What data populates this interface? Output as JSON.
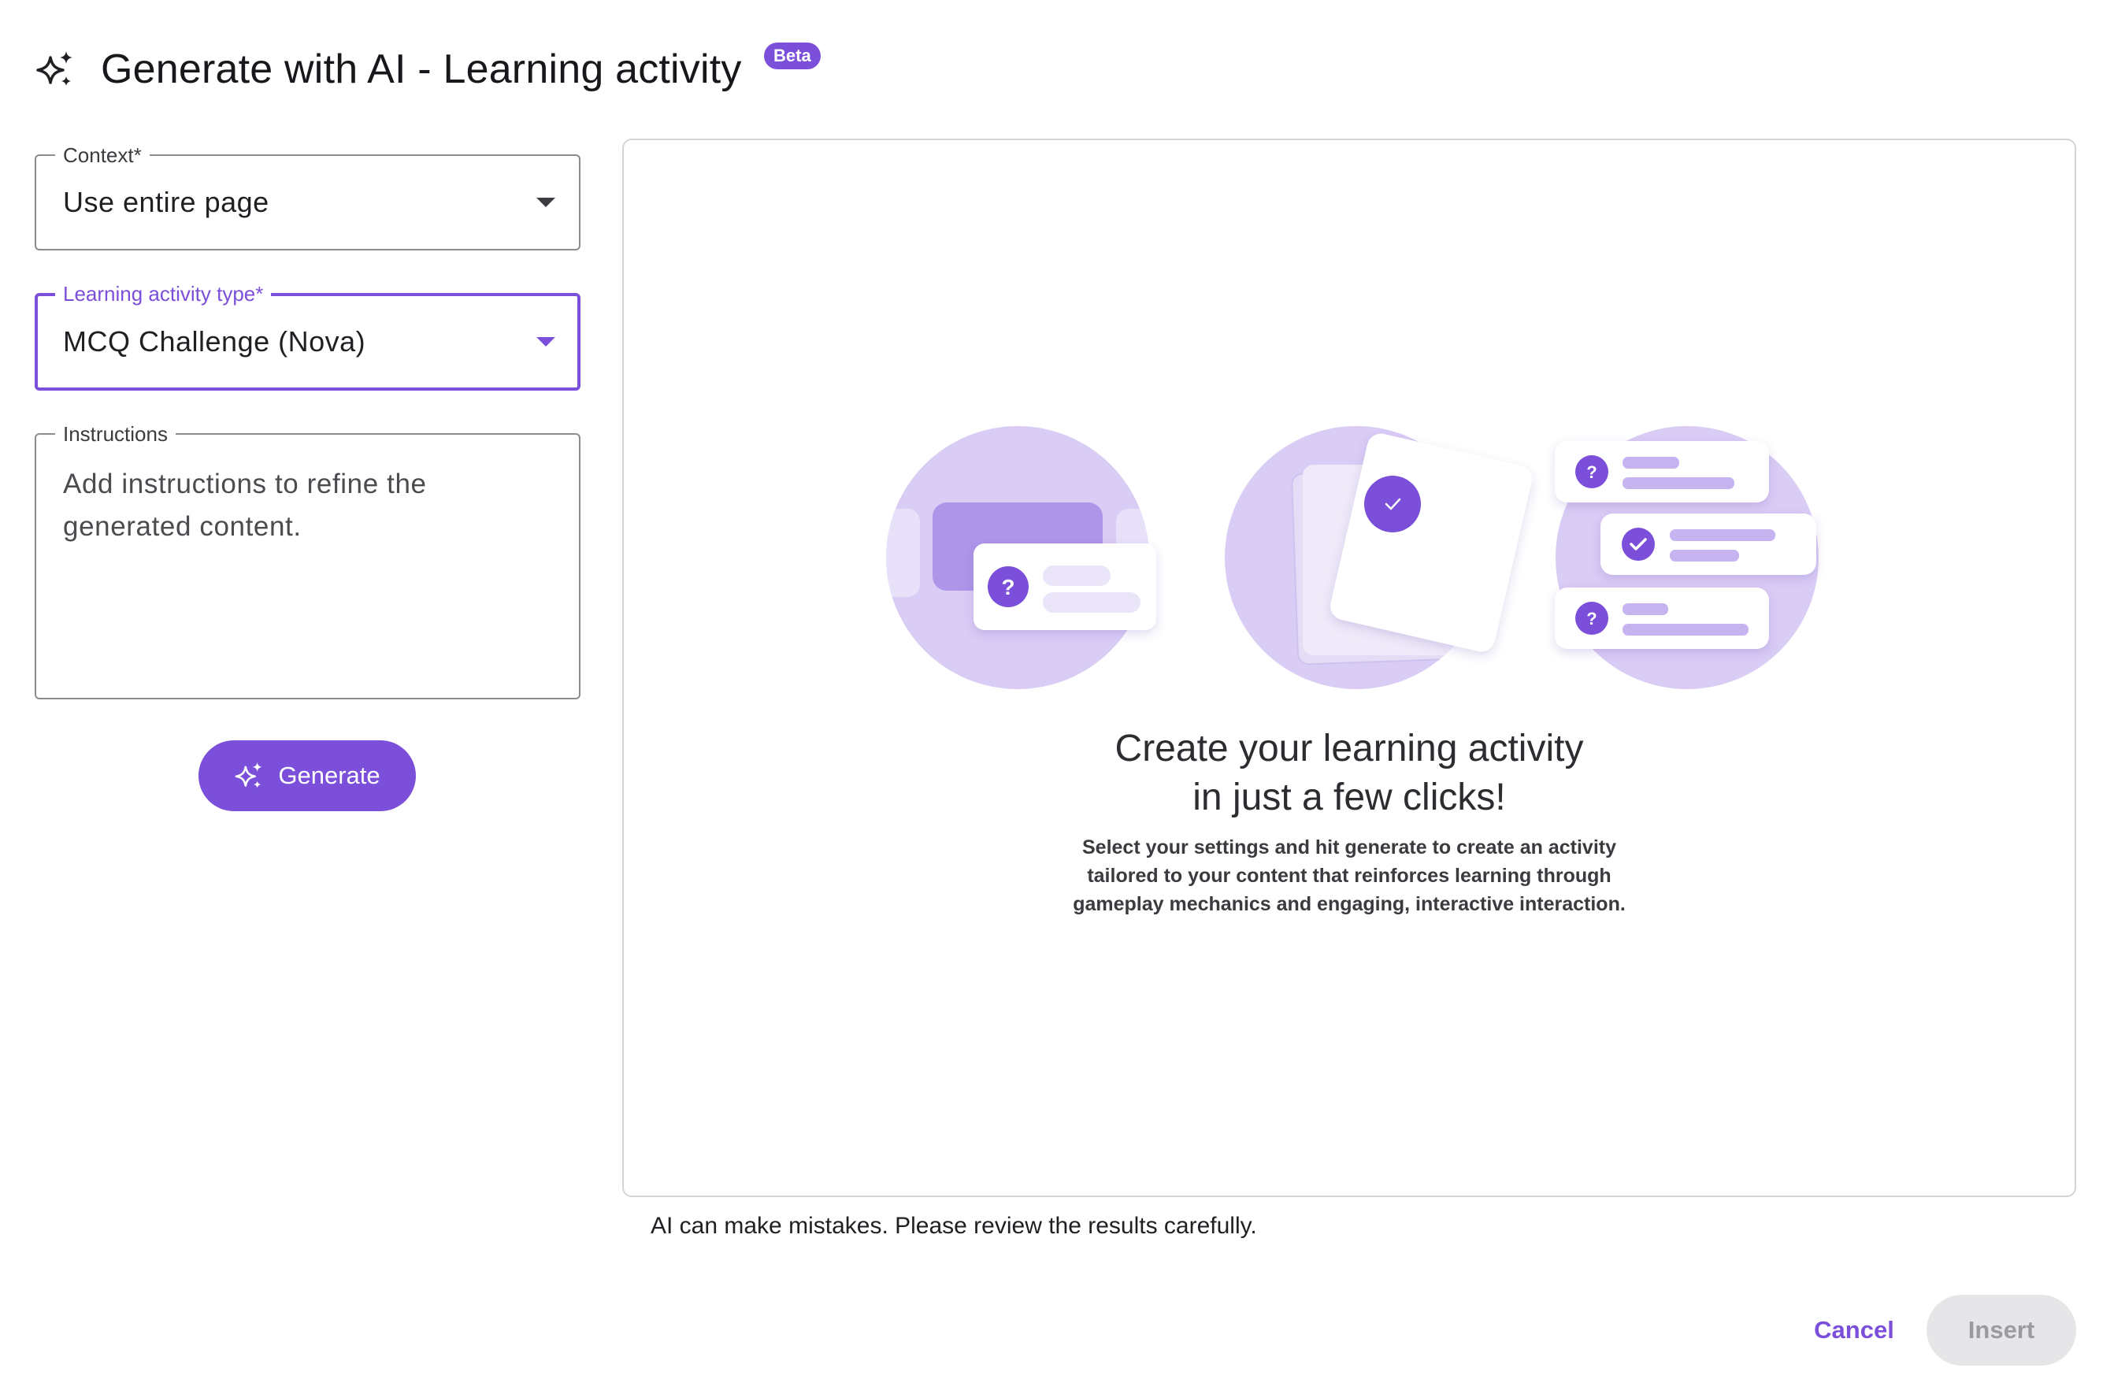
{
  "header": {
    "title": "Generate with AI - Learning activity",
    "badge": "Beta",
    "icon": "sparkles-icon"
  },
  "form": {
    "context": {
      "label": "Context*",
      "value": "Use entire page"
    },
    "activity_type": {
      "label": "Learning activity type*",
      "value": "MCQ Challenge (Nova)"
    },
    "instructions": {
      "label": "Instructions",
      "placeholder": "Add instructions to refine the generated content.",
      "value": ""
    },
    "generate_label": "Generate"
  },
  "preview": {
    "title_line1": "Create your learning activity",
    "title_line2": "in just a few clicks!",
    "desc_line1": "Select your settings and hit generate to create an activity",
    "desc_line2": "tailored to your content that reinforces learning through",
    "desc_line3": "gameplay mechanics and engaging, interactive interaction.",
    "question_mark": "?"
  },
  "disclaimer": "AI can make mistakes. Please review the results carefully.",
  "footer": {
    "cancel_label": "Cancel",
    "insert_label": "Insert"
  },
  "colors": {
    "accent": "#7b4fd9",
    "circle_fill": "#d9ccf5",
    "disabled_bg": "#e6e6e9"
  }
}
